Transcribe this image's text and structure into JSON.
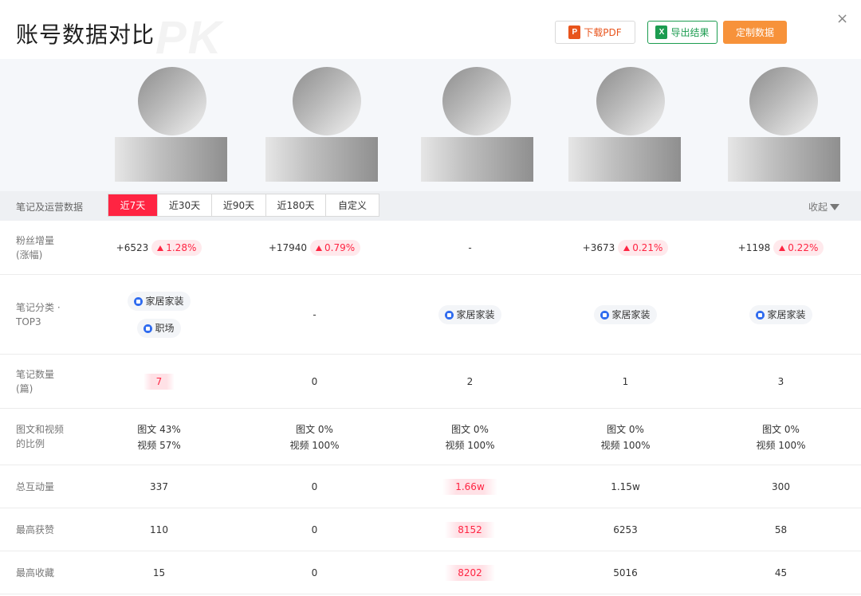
{
  "header": {
    "title": "账号数据对比",
    "watermark": "PK",
    "btn_pdf": "下载PDF",
    "btn_pdf_icon": "P",
    "btn_excel": "导出结果",
    "btn_excel_icon": "X",
    "btn_custom": "定制数据",
    "close": "×"
  },
  "tabsbar": {
    "section_label": "笔记及运营数据",
    "tabs": [
      "近7天",
      "近30天",
      "近90天",
      "近180天",
      "自定义"
    ],
    "active_tab": "近7天",
    "collapse_label": "收起"
  },
  "rows": {
    "fans": {
      "label_line1": "粉丝增量",
      "label_line2": "(涨幅)",
      "cells": [
        {
          "value": "+6523",
          "pct": "1.28%"
        },
        {
          "value": "+17940",
          "pct": "0.79%"
        },
        {
          "value": "-",
          "pct": ""
        },
        {
          "value": "+3673",
          "pct": "0.21%"
        },
        {
          "value": "+1198",
          "pct": "0.22%"
        }
      ]
    },
    "category": {
      "label_line1": "笔记分类 ·",
      "label_line2": "TOP3",
      "cells": [
        {
          "tags": [
            "家居家装",
            "职场"
          ],
          "text": ""
        },
        {
          "tags": [],
          "text": "-"
        },
        {
          "tags": [
            "家居家装"
          ],
          "text": ""
        },
        {
          "tags": [
            "家居家装"
          ],
          "text": ""
        },
        {
          "tags": [
            "家居家装"
          ],
          "text": ""
        }
      ]
    },
    "notes": {
      "label_line1": "笔记数量",
      "label_line2": "(篇)",
      "cells": [
        "7",
        "0",
        "2",
        "1",
        "3"
      ],
      "highlight_index": 0
    },
    "ratio": {
      "label_line1": "图文和视频",
      "label_line2": "的比例",
      "cells": [
        {
          "line1": "图文 43%",
          "line2": "视频 57%"
        },
        {
          "line1": "图文 0%",
          "line2": "视频 100%"
        },
        {
          "line1": "图文 0%",
          "line2": "视频 100%"
        },
        {
          "line1": "图文 0%",
          "line2": "视频 100%"
        },
        {
          "line1": "图文 0%",
          "line2": "视频 100%"
        }
      ]
    },
    "interactions": {
      "label": "总互动量",
      "cells": [
        "337",
        "0",
        "1.66w",
        "1.15w",
        "300"
      ],
      "highlight_index": 2
    },
    "likes": {
      "label": "最高获赞",
      "cells": [
        "110",
        "0",
        "8152",
        "6253",
        "58"
      ],
      "highlight_index": 2
    },
    "favorites": {
      "label": "最高收藏",
      "cells": [
        "15",
        "0",
        "8202",
        "5016",
        "45"
      ],
      "highlight_index": 2
    }
  },
  "colors": {
    "accent_red": "#ff2442",
    "orange": "#f7923a",
    "excel_green": "#1c9c50",
    "pdf_orange": "#e8541c",
    "tag_icon_blue": "#2f6bef"
  }
}
